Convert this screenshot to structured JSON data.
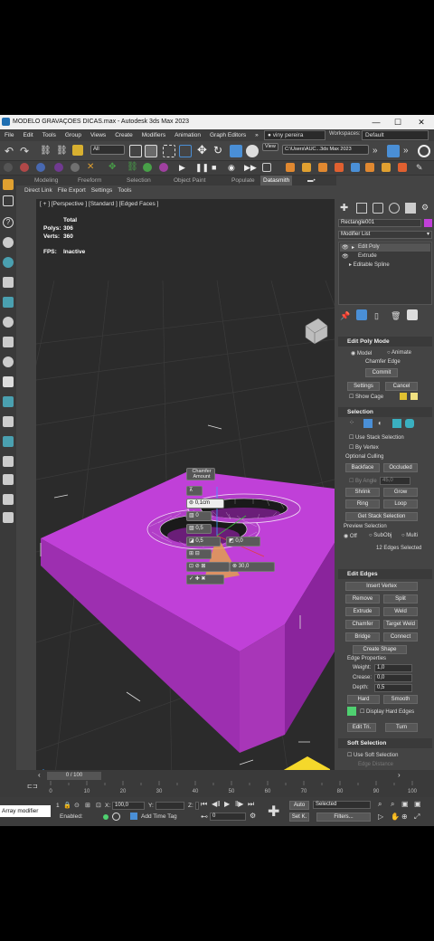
{
  "window": {
    "title": "MODELO GRAVAÇOES DICAS.max - Autodesk 3ds Max 2023",
    "minimize": "—",
    "maximize": "☐",
    "close": "✕"
  },
  "menu": [
    "File",
    "Edit",
    "Tools",
    "Group",
    "Views",
    "Create",
    "Modifiers",
    "Animation",
    "Graph Editors",
    "»"
  ],
  "user": {
    "name": "viny pereira",
    "workspace_label": "Workspaces:",
    "workspace_value": "Default"
  },
  "toolbar": {
    "selection_filter": "All",
    "view_label": "View",
    "path": "C:\\Users\\AUC...3ds Max 2023"
  },
  "ribbon_tabs": [
    "Modeling",
    "Freeform",
    "Selection",
    "Object Paint",
    "Populate",
    "Datasmith"
  ],
  "ribbon_active": "Datasmith",
  "sub_ribbon": [
    "Direct Link",
    "File Export",
    "Settings",
    "Tools"
  ],
  "viewport": {
    "label": "[ + ] [Perspective ] [Standard ] [Edged Faces ]",
    "stats": {
      "total_label": "Total",
      "polys_label": "Polys:",
      "polys": "306",
      "verts_label": "Verts:",
      "verts": "360",
      "fps_label": "FPS:",
      "fps": "Inactive"
    },
    "caddy": {
      "title": "Chamfer Amount",
      "amount": "0,1cm",
      "segments": "0",
      "tension": "0,5",
      "depth": "0,5",
      "end_bias": "0,0",
      "threshold": "30,0"
    }
  },
  "command_panel": {
    "object_name": "Rectangle001",
    "modifier_list": "Modifier List",
    "stack": [
      "Edit Poly",
      "Extrude",
      "Editable Spline"
    ],
    "edit_poly_mode": {
      "title": "Edit Poly Mode",
      "model": "Model",
      "animate": "Animate",
      "current": "Chamfer Edge",
      "commit": "Commit",
      "settings": "Settings",
      "cancel": "Cancel",
      "show_cage": "Show Cage"
    },
    "selection": {
      "title": "Selection",
      "use_stack": "Use Stack Selection",
      "by_vertex": "By Vertex",
      "optional_culling": "Optional Culling",
      "backface": "Backface",
      "occluded": "Occluded",
      "by_angle": "By Angle",
      "angle_value": "45,0",
      "shrink": "Shrink",
      "grow": "Grow",
      "ring": "Ring",
      "loop": "Loop",
      "get_stack": "Get Stack Selection",
      "preview": "Preview Selection",
      "off": "Off",
      "subobj": "SubObj",
      "multi": "Multi",
      "status": "12 Edges Selected"
    },
    "edit_edges": {
      "title": "Edit Edges",
      "insert_vertex": "Insert Vertex",
      "remove": "Remove",
      "split": "Split",
      "extrude": "Extrude",
      "weld": "Weld",
      "chamfer": "Chamfer",
      "target_weld": "Target Weld",
      "bridge": "Bridge",
      "connect": "Connect",
      "create_shape": "Create Shape",
      "edge_properties": "Edge Properties",
      "weight_label": "Weight:",
      "weight": "1,0",
      "crease_label": "Crease:",
      "crease": "0,0",
      "depth_label": "Depth:",
      "depth": "0,5",
      "hard": "Hard",
      "smooth": "Smooth",
      "display_hard": "Display Hard Edges",
      "edit_tri": "Edit Tri.",
      "turn": "Turn"
    },
    "soft_selection": {
      "title": "Soft Selection",
      "use": "Use Soft Selection",
      "edge_distance": "Edge Distance"
    }
  },
  "timeline": {
    "frame": "0 / 100",
    "ticks": [
      "0",
      "10",
      "20",
      "30",
      "40",
      "50",
      "60",
      "70",
      "80",
      "90",
      "100"
    ]
  },
  "status": {
    "script_label": "Array modifier",
    "selected_count": "1",
    "x_label": "X:",
    "x_value": "100,0",
    "y_label": "Y:",
    "z_label": "Z:",
    "enabled": "Enabled:",
    "add_time_tag": "Add Time Tag",
    "frame_field": "0",
    "auto": "Auto",
    "selected": "Selected",
    "set_k": "Set K.",
    "filters": "Filters..."
  },
  "colors": {
    "object": "#c040d8",
    "object_dark": "#8a249c",
    "accent": "#4a8fd6",
    "logo": "#f5d82b",
    "viewport_bg": "#2b2b2b"
  }
}
